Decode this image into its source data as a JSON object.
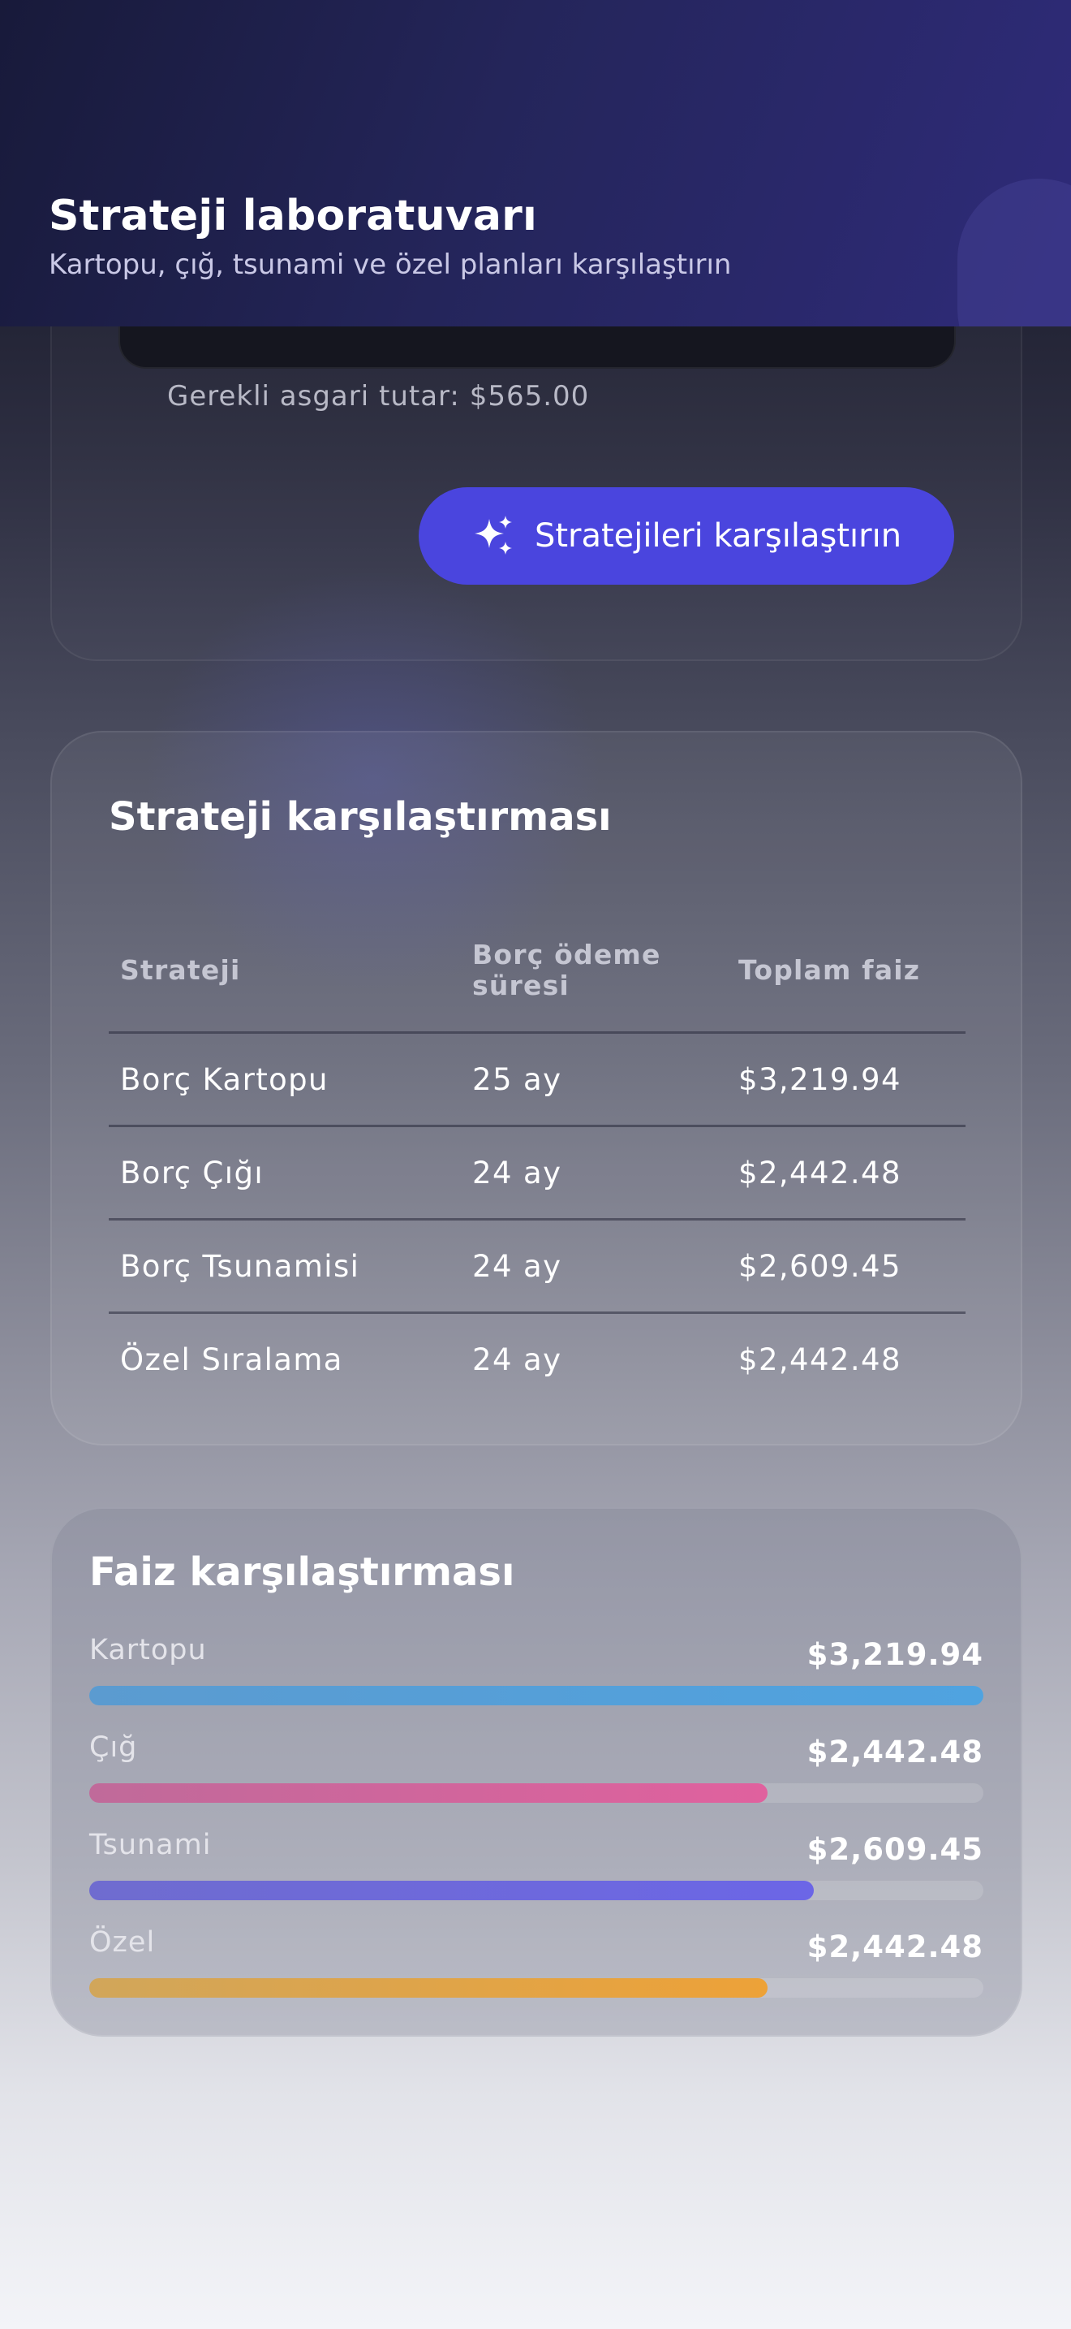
{
  "header": {
    "title": "Strateji laboratuvarı",
    "subtitle": "Kartopu, çığ, tsunami ve özel planları karşılaştırın"
  },
  "form": {
    "min_payment_text": "Gerekli asgari tutar: $565.00",
    "compare_button_label": "Stratejileri karşılaştırın",
    "compare_button_icon": "sparkles-icon",
    "accent_color": "#4a45de"
  },
  "comparison_table": {
    "title": "Strateji karşılaştırması",
    "headers": [
      "Strateji",
      "Borç ödeme süresi",
      "Toplam faiz"
    ],
    "rows": [
      [
        "Borç Kartopu",
        "25 ay",
        "$3,219.94"
      ],
      [
        "Borç Çığı",
        "24 ay",
        "$2,442.48"
      ],
      [
        "Borç Tsunamisi",
        "24 ay",
        "$2,609.45"
      ],
      [
        "Özel Sıralama",
        "24 ay",
        "$2,442.48"
      ]
    ]
  },
  "interest_comparison": {
    "title": "Faiz karşılaştırması",
    "items": [
      {
        "label": "Kartopu",
        "amount": "$3,219.94",
        "fraction": 1.0,
        "color_start": "#5b9bd0",
        "color_end": "#4fa3e0"
      },
      {
        "label": "Çığ",
        "amount": "$2,442.48",
        "fraction": 0.7586,
        "color_start": "#c06a9a",
        "color_end": "#e0619e"
      },
      {
        "label": "Tsunami",
        "amount": "$2,609.45",
        "fraction": 0.8104,
        "color_start": "#6f6ccf",
        "color_end": "#6c66e6"
      },
      {
        "label": "Özel",
        "amount": "$2,442.48",
        "fraction": 0.7586,
        "color_start": "#d1a65a",
        "color_end": "#eda238"
      }
    ]
  }
}
